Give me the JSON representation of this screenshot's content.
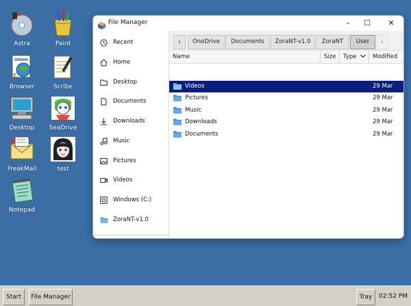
{
  "desktop": {
    "icons": [
      {
        "label": "Astra",
        "icon": "cd-disc-icon"
      },
      {
        "label": "Paint",
        "icon": "paint-bucket-icon"
      },
      {
        "label": "Browser",
        "icon": "browser-icon"
      },
      {
        "label": "Scribe",
        "icon": "notepad-pen-icon"
      },
      {
        "label": "Desktop",
        "icon": "computer-monitor-icon"
      },
      {
        "label": "SeaDrive",
        "icon": "seadrive-icon"
      },
      {
        "label": "FreakMail",
        "icon": "mail-icon"
      },
      {
        "label": "test",
        "icon": "anime-character-icon"
      },
      {
        "label": "Notepad",
        "icon": "notepad-icon"
      }
    ]
  },
  "window": {
    "title": "File Manager",
    "controls": {
      "minimize": "–",
      "maximize": "☐",
      "close": "✕"
    }
  },
  "sidebar": {
    "items": [
      {
        "label": "Recent",
        "icon": "clock-icon"
      },
      {
        "label": "Home",
        "icon": "home-icon"
      },
      {
        "label": "Desktop",
        "icon": "desktop-folder-icon"
      },
      {
        "label": "Documents",
        "icon": "document-icon"
      },
      {
        "label": "Downloads",
        "icon": "download-icon"
      },
      {
        "label": "Music",
        "icon": "music-icon"
      },
      {
        "label": "Pictures",
        "icon": "pictures-icon"
      },
      {
        "label": "Videos",
        "icon": "video-icon"
      },
      {
        "label": "Windows (C:)",
        "icon": "drive-icon"
      },
      {
        "label": "ZoraNT-v1.0",
        "icon": "folder-icon"
      }
    ]
  },
  "breadcrumb": {
    "back": "‹",
    "forward": "›",
    "items": [
      "OneDrive",
      "Documents",
      "ZoraNT-v1.0",
      "ZoraNT",
      "User"
    ],
    "active": "User"
  },
  "columns": {
    "name": "Name",
    "size": "Size",
    "type": "Type",
    "modified": "Modified"
  },
  "files": [
    {
      "name": "Videos",
      "modified": "29 Mar",
      "selected": true
    },
    {
      "name": "Pictures",
      "modified": "29 Mar",
      "selected": false
    },
    {
      "name": "Music",
      "modified": "29 Mar",
      "selected": false
    },
    {
      "name": "Downloads",
      "modified": "29 Mar",
      "selected": false
    },
    {
      "name": "Documents",
      "modified": "29 Mar",
      "selected": false
    }
  ],
  "taskbar": {
    "start": "Start",
    "apps": [
      "File Manager"
    ],
    "tray": "Tray",
    "clock": "02:52 PM"
  },
  "colors": {
    "desktop": "#3a6ea5",
    "selection": "#0a1f7a",
    "folder": "#5b9bd5"
  }
}
